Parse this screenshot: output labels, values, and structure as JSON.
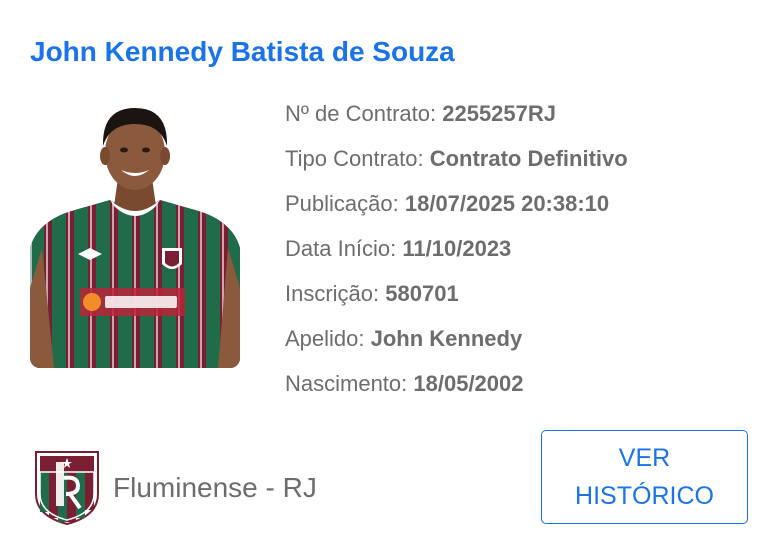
{
  "player": {
    "name": "John Kennedy Batista de Souza"
  },
  "details": [
    {
      "label": "Nº de Contrato: ",
      "value": "2255257RJ"
    },
    {
      "label": "Tipo Contrato: ",
      "value": "Contrato Definitivo"
    },
    {
      "label": "Publicação: ",
      "value": "18/07/2025 20:38:10"
    },
    {
      "label": "Data Início: ",
      "value": "11/10/2023"
    },
    {
      "label": "Inscrição: ",
      "value": "580701"
    },
    {
      "label": "Apelido: ",
      "value": "John Kennedy"
    },
    {
      "label": "Nascimento: ",
      "value": "18/05/2002"
    }
  ],
  "club": {
    "name": "Fluminense - RJ",
    "crest_icon": "club-crest-icon"
  },
  "history_button": {
    "label": "VER HISTÓRICO"
  },
  "colors": {
    "accent": "#1a73e8",
    "text": "#6d6d6d",
    "jersey_garnet": "#7a1f33",
    "jersey_green": "#1f6b4a"
  }
}
